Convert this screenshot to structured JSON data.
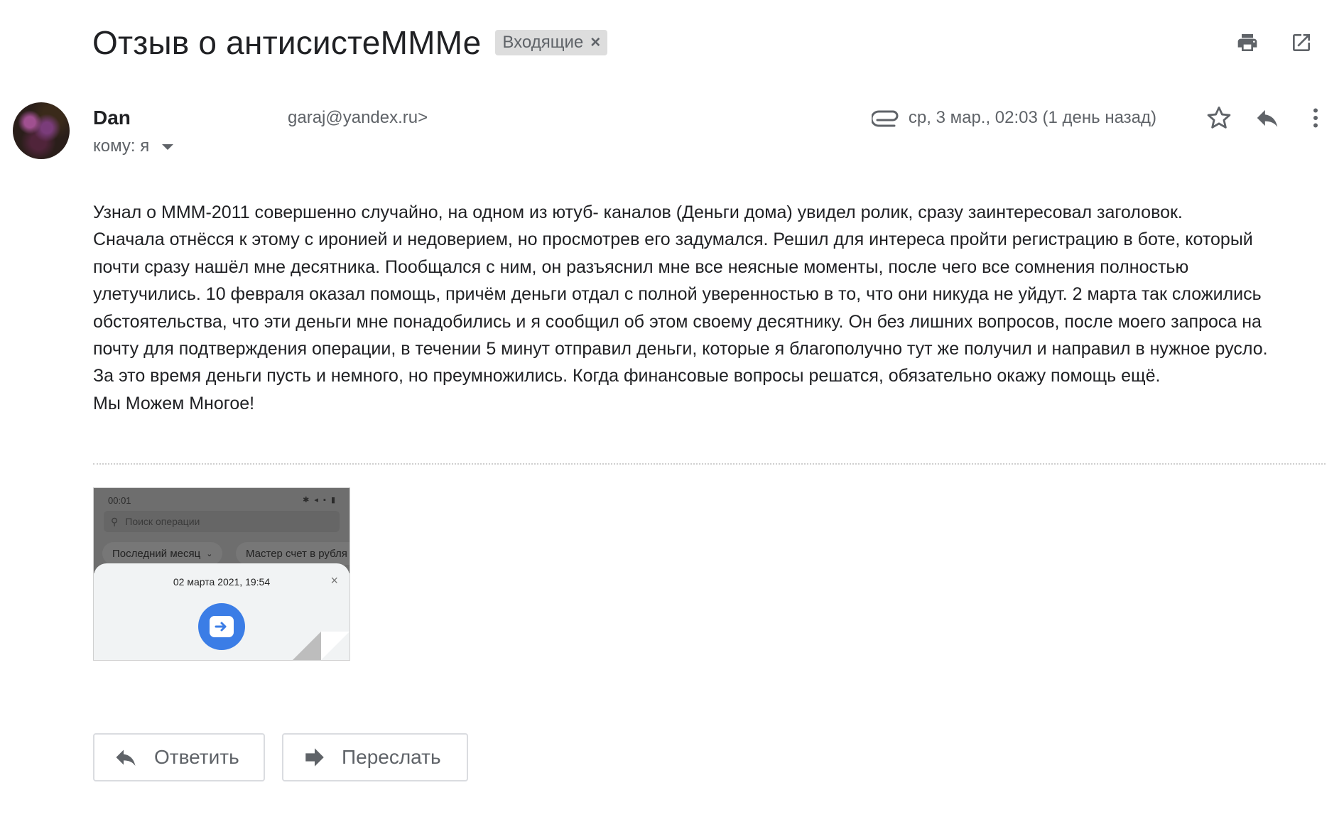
{
  "subject": {
    "title": "Отзыв о антисистеМММе",
    "label": "Входящие",
    "label_close": "×"
  },
  "top_actions": {
    "print_icon": "printer-icon",
    "open_new_window_icon": "open-in-new-icon"
  },
  "sender": {
    "name": "Dan",
    "email": "garaj@yandex.ru>",
    "recipient": "кому: я"
  },
  "meta": {
    "attachment_icon": "paperclip-icon",
    "date": "ср, 3 мар., 02:03 (1 день назад)",
    "star_icon": "star-icon",
    "reply_icon": "reply-icon",
    "more_icon": "more-vert-icon"
  },
  "body": {
    "lines": [
      "Узнал о МММ-2011 совершенно случайно,  на одном из ютуб- каналов (Деньги дома) увидел ролик,  сразу заинтересовал заголовок.",
      "Сначала отнёсся к этому с иронией и недоверием, но просмотрев его задумался.  Решил для интереса пройти регистрацию в боте,  который",
      "почти сразу нашёл мне десятника.  Пообщался с ним, он разъяснил мне все неясные моменты, после чего все сомнения полностью",
      "улетучились. 10 февраля оказал помощь, причём деньги отдал с полной уверенностью в то, что они никуда не уйдут. 2 марта так сложились",
      "обстоятельства,  что эти деньги мне понадобились и я сообщил об этом своему десятнику. Он без лишних вопросов, после моего запроса на",
      "почту для подтверждения операции, в течении 5 минут отправил деньги, которые я благополучно тут же получил и направил в нужное русло.",
      "За это время деньги пусть и немного, но преумножились. Когда финансовые вопросы решатся, обязательно окажу помощь ещё.",
      "Мы Можем Многое!"
    ]
  },
  "attachment": {
    "status_time": "00:01",
    "search_placeholder": "Поиск операции",
    "chip_period": "Последний месяц",
    "chip_account": "Мастер счет в рубля",
    "sheet_date": "02 марта 2021, 19:54",
    "sheet_close": "×"
  },
  "buttons": {
    "reply": "Ответить",
    "forward": "Переслать"
  },
  "colors": {
    "label_bg": "#dddddd",
    "secondary_text": "#5f6368",
    "primary_text": "#202124",
    "accent_blue": "#3b7de6"
  }
}
